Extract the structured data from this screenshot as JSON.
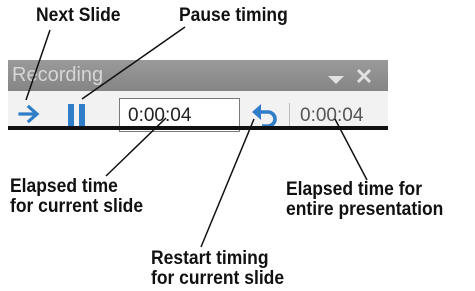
{
  "callouts": {
    "next_slide": "Next Slide",
    "pause_timing": "Pause timing",
    "elapsed_slide_line1": "Elapsed time",
    "elapsed_slide_line2": "for current slide",
    "elapsed_presentation_line1": "Elapsed time for",
    "elapsed_presentation_line2": "entire presentation",
    "restart_line1": "Restart timing",
    "restart_line2": "for current slide"
  },
  "toolbar": {
    "title": "Recording",
    "slide_time": "0:00:04",
    "total_time": "0:00:04",
    "icons": [
      "next-arrow-icon",
      "pause-icon",
      "repeat-icon",
      "dropdown-icon",
      "close-icon"
    ],
    "colors": {
      "accent": "#2f7ec7",
      "titlebar": "#8c8c8c",
      "body": "#f2f2f2"
    }
  }
}
